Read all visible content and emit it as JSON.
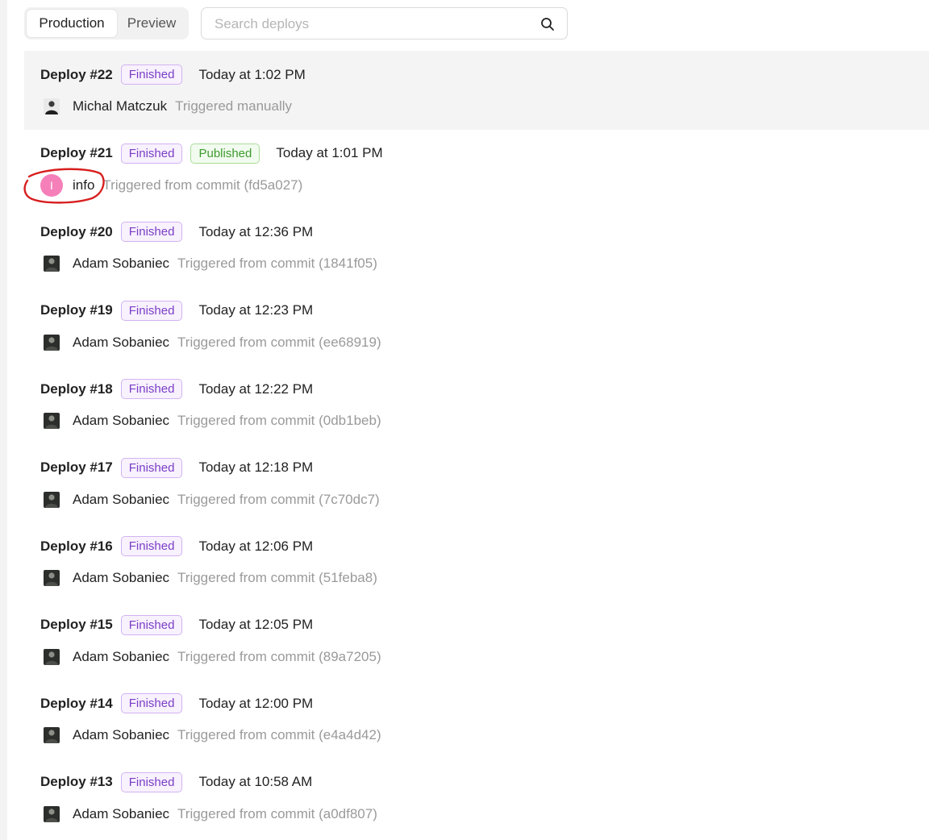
{
  "tabs": [
    {
      "label": "Production",
      "active": true
    },
    {
      "label": "Preview",
      "active": false
    }
  ],
  "search": {
    "placeholder": "Search deploys",
    "value": "",
    "icon": "search-icon"
  },
  "colors": {
    "finished": "#7a3ec6",
    "published": "#3d9b2e",
    "initial_avatar": "#f57fb9",
    "annotation": "#d81f1f"
  },
  "deploys": [
    {
      "title": "Deploy #22",
      "badges": [
        {
          "label": "Finished",
          "kind": "finished"
        }
      ],
      "time": "Today at 1:02 PM",
      "author": "Michal Matczuk",
      "avatar": "photo-light",
      "trigger": "Triggered manually",
      "highlighted": true
    },
    {
      "title": "Deploy #21",
      "badges": [
        {
          "label": "Finished",
          "kind": "finished"
        },
        {
          "label": "Published",
          "kind": "published"
        }
      ],
      "time": "Today at 1:01 PM",
      "author": "info",
      "avatar_initial": "I",
      "avatar": "initial",
      "trigger": "Triggered from commit (fd5a027)",
      "annotated": true
    },
    {
      "title": "Deploy #20",
      "badges": [
        {
          "label": "Finished",
          "kind": "finished"
        }
      ],
      "time": "Today at 12:36 PM",
      "author": "Adam Sobaniec",
      "avatar": "photo-dark",
      "trigger": "Triggered from commit (1841f05)"
    },
    {
      "title": "Deploy #19",
      "badges": [
        {
          "label": "Finished",
          "kind": "finished"
        }
      ],
      "time": "Today at 12:23 PM",
      "author": "Adam Sobaniec",
      "avatar": "photo-dark",
      "trigger": "Triggered from commit (ee68919)"
    },
    {
      "title": "Deploy #18",
      "badges": [
        {
          "label": "Finished",
          "kind": "finished"
        }
      ],
      "time": "Today at 12:22 PM",
      "author": "Adam Sobaniec",
      "avatar": "photo-dark",
      "trigger": "Triggered from commit (0db1beb)"
    },
    {
      "title": "Deploy #17",
      "badges": [
        {
          "label": "Finished",
          "kind": "finished"
        }
      ],
      "time": "Today at 12:18 PM",
      "author": "Adam Sobaniec",
      "avatar": "photo-dark",
      "trigger": "Triggered from commit (7c70dc7)"
    },
    {
      "title": "Deploy #16",
      "badges": [
        {
          "label": "Finished",
          "kind": "finished"
        }
      ],
      "time": "Today at 12:06 PM",
      "author": "Adam Sobaniec",
      "avatar": "photo-dark",
      "trigger": "Triggered from commit (51feba8)"
    },
    {
      "title": "Deploy #15",
      "badges": [
        {
          "label": "Finished",
          "kind": "finished"
        }
      ],
      "time": "Today at 12:05 PM",
      "author": "Adam Sobaniec",
      "avatar": "photo-dark",
      "trigger": "Triggered from commit (89a7205)"
    },
    {
      "title": "Deploy #14",
      "badges": [
        {
          "label": "Finished",
          "kind": "finished"
        }
      ],
      "time": "Today at 12:00 PM",
      "author": "Adam Sobaniec",
      "avatar": "photo-dark",
      "trigger": "Triggered from commit (e4a4d42)"
    },
    {
      "title": "Deploy #13",
      "badges": [
        {
          "label": "Finished",
          "kind": "finished"
        }
      ],
      "time": "Today at 10:58 AM",
      "author": "Adam Sobaniec",
      "avatar": "photo-dark",
      "trigger": "Triggered from commit (a0df807)"
    }
  ]
}
